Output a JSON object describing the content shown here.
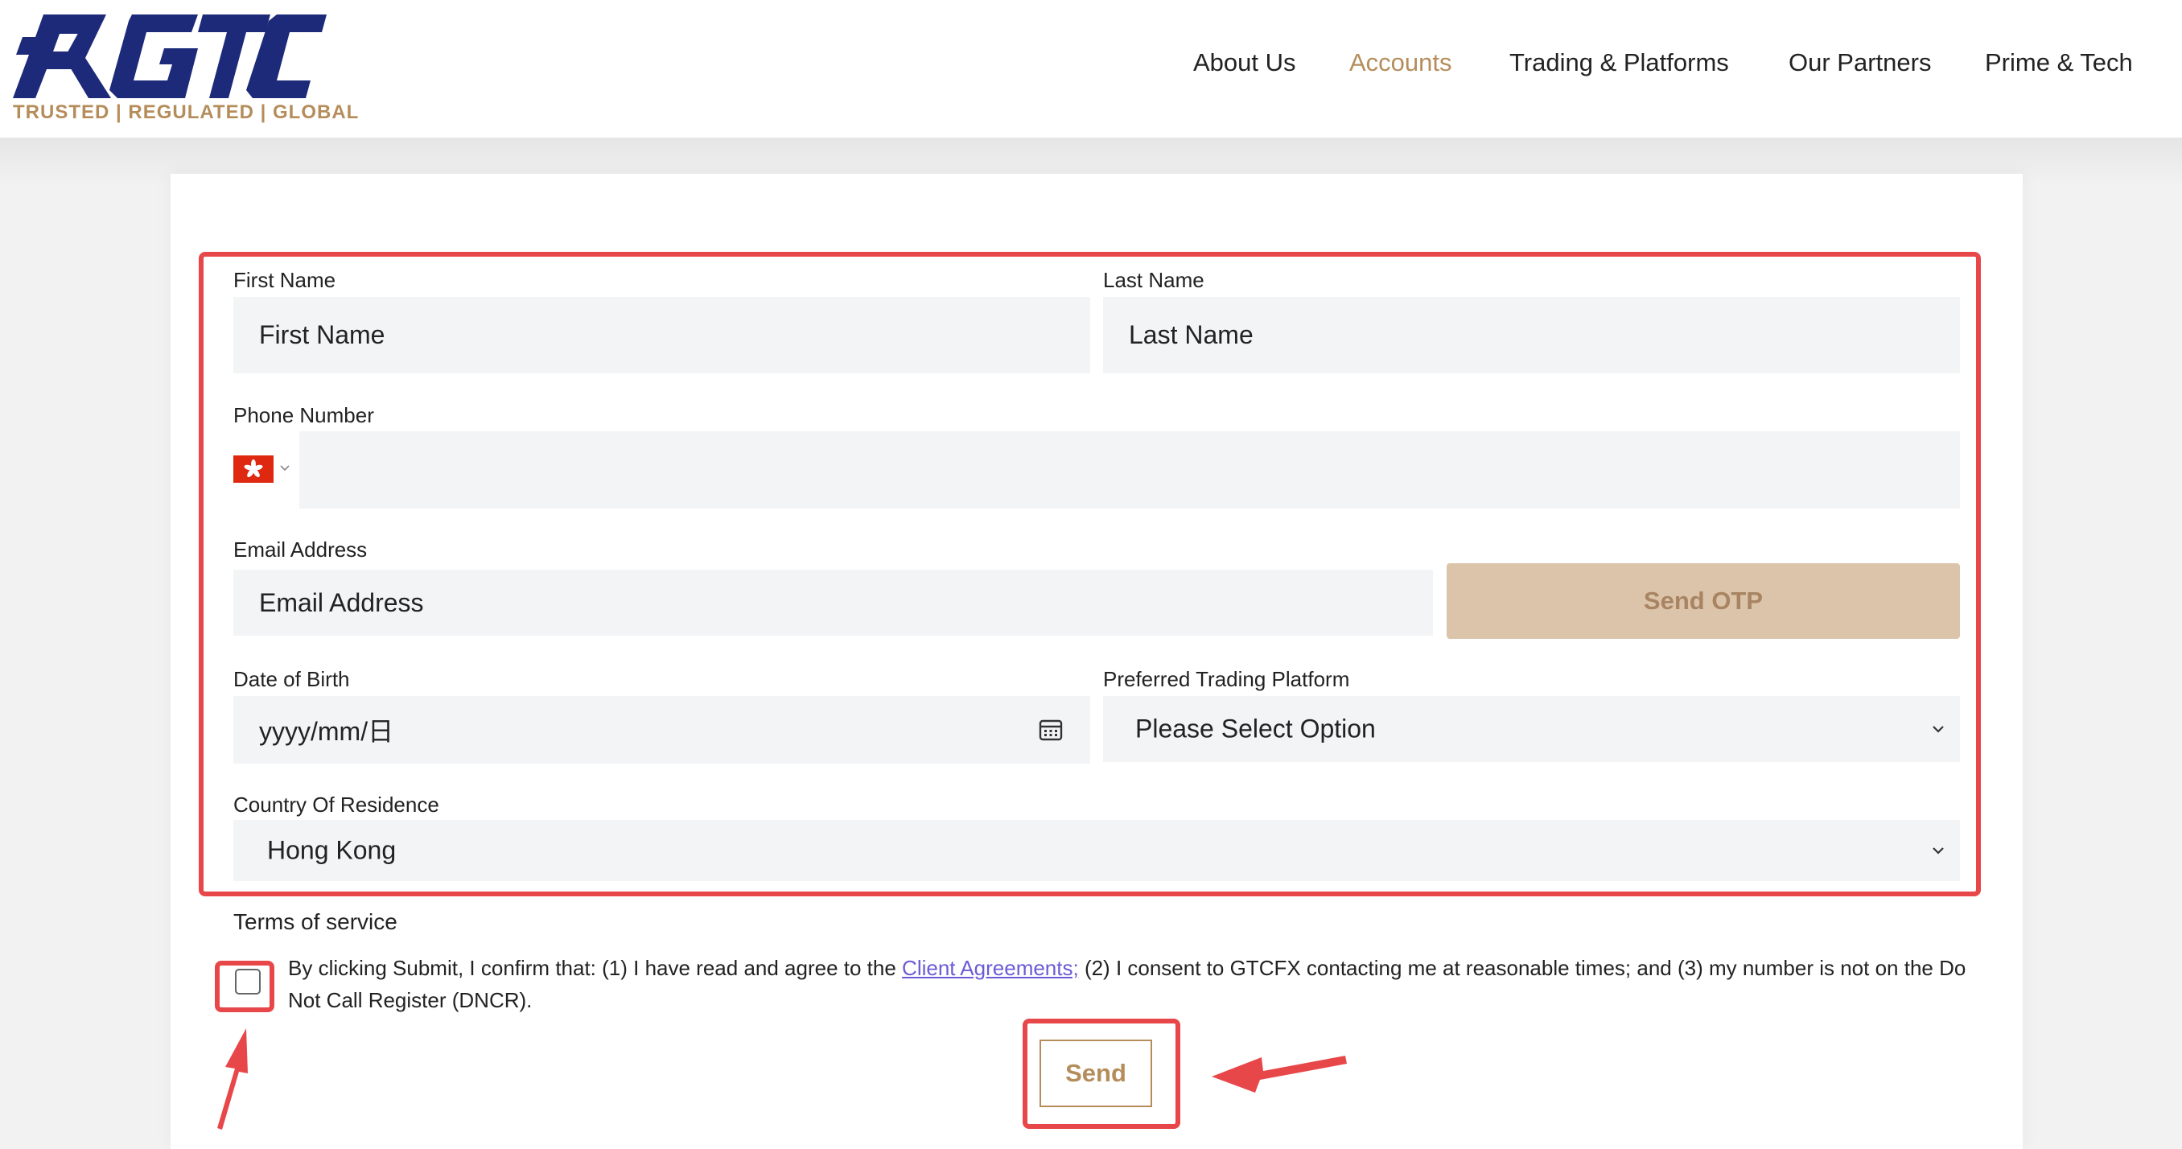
{
  "header": {
    "logo_text": "GTC",
    "tagline": "TRUSTED | REGULATED | GLOBAL",
    "nav": [
      {
        "label": "About Us"
      },
      {
        "label": "Accounts",
        "active": true
      },
      {
        "label": "Trading & Platforms"
      },
      {
        "label": "Our Partners"
      },
      {
        "label": "Prime & Tech"
      }
    ]
  },
  "form": {
    "first_name": {
      "label": "First Name",
      "placeholder": "First Name",
      "value": ""
    },
    "last_name": {
      "label": "Last Name",
      "placeholder": "Last Name",
      "value": ""
    },
    "phone": {
      "label": "Phone Number",
      "country_flag": "hong-kong-flag",
      "value": ""
    },
    "email": {
      "label": "Email Address",
      "placeholder": "Email Address",
      "value": ""
    },
    "send_otp_label": "Send OTP",
    "dob": {
      "label": "Date of Birth",
      "value": "yyyy/mm/日"
    },
    "platform": {
      "label": "Preferred Trading Platform",
      "value": "Please Select Option"
    },
    "country": {
      "label": "Country Of Residence",
      "value": "Hong Kong"
    },
    "terms": {
      "title": "Terms of service",
      "text_before": "By clicking Submit, I confirm that: (1) I have read and agree to the ",
      "link": "Client Agreements;",
      "text_after": " (2) I consent to GTCFX contacting me at reasonable times; and (3) my number is not on the Do Not Call Register (DNCR).",
      "checked": false
    },
    "send_label": "Send"
  },
  "colors": {
    "accent": "#b58d5b",
    "otp_button_bg": "#dcc4aa",
    "field_bg": "#f3f4f6",
    "annotation": "#e8474a",
    "logo_navy": "#1d2a7a",
    "link": "#6b5bd6"
  }
}
